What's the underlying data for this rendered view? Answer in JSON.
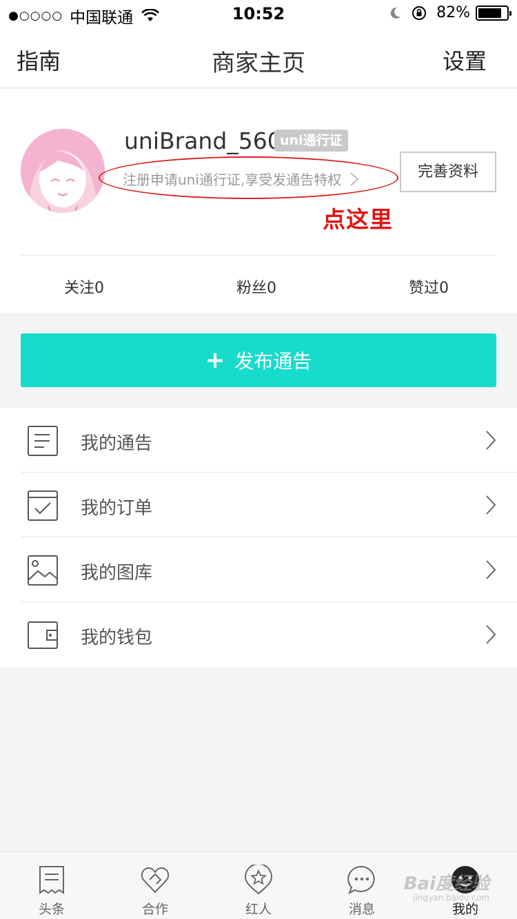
{
  "status_bar": {
    "signal": "●○○○○",
    "carrier": "中国联通",
    "time": "10:52",
    "battery_percent": "82%",
    "battery_level": 0.82
  },
  "nav": {
    "left": "指南",
    "title": "商家主页",
    "right": "设置"
  },
  "profile": {
    "username": "uniBrand_560",
    "badge": "uni通行证",
    "register_prompt": "注册申请uni通行证,享受发通告特权",
    "complete_button": "完善资料",
    "annotation": "点这里",
    "stats": {
      "follow": "关注0",
      "fans": "粉丝0",
      "likes": "赞过0"
    }
  },
  "publish": {
    "plus": "+",
    "label": "发布通告"
  },
  "menu": [
    {
      "label": "我的通告",
      "icon": "document-icon"
    },
    {
      "label": "我的订单",
      "icon": "order-check-icon"
    },
    {
      "label": "我的图库",
      "icon": "image-icon"
    },
    {
      "label": "我的钱包",
      "icon": "wallet-icon"
    }
  ],
  "tabs": [
    {
      "label": "头条",
      "icon": "news-icon"
    },
    {
      "label": "合作",
      "icon": "handshake-heart-icon"
    },
    {
      "label": "红人",
      "icon": "star-badge-icon"
    },
    {
      "label": "消息",
      "icon": "chat-bubble-icon"
    },
    {
      "label": "我的",
      "icon": "face-icon"
    }
  ],
  "watermark": {
    "text": "Bai度经验",
    "sub": "jingyan.baidu.com"
  },
  "colors": {
    "accent": "#18dccb",
    "annotation_red": "#e11414",
    "avatar_pink": "#f4b3ce"
  }
}
